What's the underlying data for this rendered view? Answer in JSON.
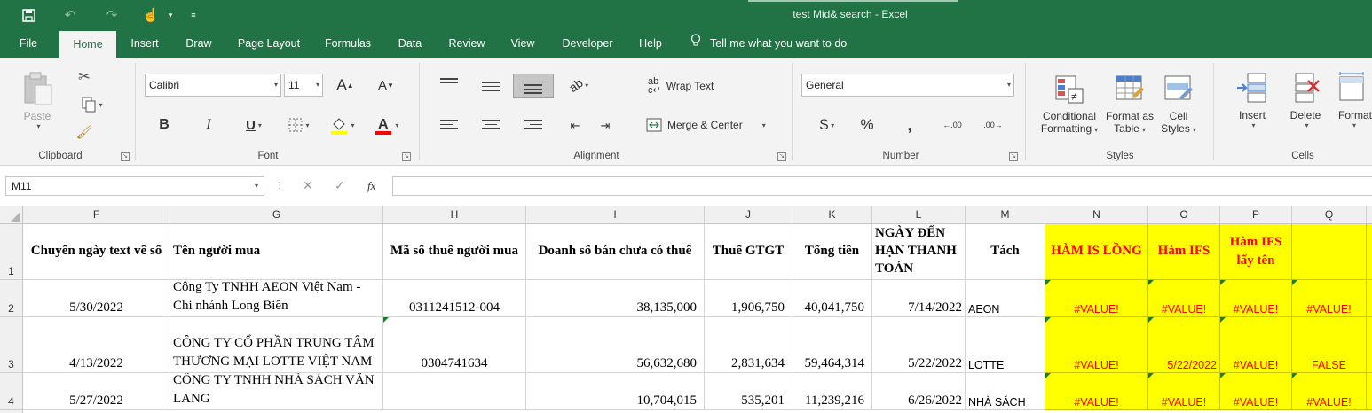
{
  "window": {
    "title": "test Mid& search  -  Excel"
  },
  "tabs": [
    "File",
    "Home",
    "Insert",
    "Draw",
    "Page Layout",
    "Formulas",
    "Data",
    "Review",
    "View",
    "Developer",
    "Help"
  ],
  "active_tab": "Home",
  "tell_me": "Tell me what you want to do",
  "ribbon": {
    "clipboard": {
      "paste": "Paste",
      "label": "Clipboard"
    },
    "font": {
      "name": "Calibri",
      "size": "11",
      "grow": "A",
      "shrink": "A",
      "bold": "B",
      "italic": "I",
      "underline": "U",
      "label": "Font"
    },
    "alignment": {
      "wrap": "Wrap Text",
      "merge": "Merge & Center",
      "label": "Alignment"
    },
    "number": {
      "format": "General",
      "currency": "$",
      "percent": "%",
      "comma": ",",
      "inc_decimal": ".00",
      "dec_decimal": ".00",
      "label": "Number"
    },
    "styles": {
      "conditional_1": "Conditional",
      "conditional_2": "Formatting",
      "table_1": "Format as",
      "table_2": "Table",
      "cell_1": "Cell",
      "cell_2": "Styles",
      "label": "Styles"
    },
    "cells": {
      "insert": "Insert",
      "delete": "Delete",
      "format": "Format",
      "label": "Cells"
    }
  },
  "formula_bar": {
    "name_box": "M11",
    "fx": "fx",
    "formula": ""
  },
  "sheet": {
    "columns": [
      "F",
      "G",
      "H",
      "I",
      "J",
      "K",
      "L",
      "M",
      "N",
      "O",
      "P",
      "Q"
    ],
    "row_numbers": [
      "1",
      "2",
      "3",
      "4"
    ],
    "header_row": {
      "F": "Chuyển ngày text về số",
      "G": "Tên người mua",
      "H": "Mã số thuế người mua",
      "I": "Doanh số bán chưa có thuế",
      "J": "Thuế GTGT",
      "K": "Tổng tiền",
      "L": "NGÀY ĐẾN HẠN THANH TOÁN",
      "M": "Tách",
      "N": "HÀM IS LỒNG",
      "O": "Hàm IFS",
      "P": "Hàm IFS lấy tên",
      "Q": ""
    },
    "rows": [
      {
        "F": "5/30/2022",
        "G": "Công Ty TNHH AEON Việt Nam - Chi nhánh Long Biên",
        "H": "0311241512-004",
        "I": "38,135,000",
        "J": "1,906,750",
        "K": "40,041,750",
        "L": "7/14/2022",
        "M": "AEON",
        "N": "#VALUE!",
        "O": "#VALUE!",
        "P": "#VALUE!",
        "Q": "#VALUE!"
      },
      {
        "F": "4/13/2022",
        "G": "CÔNG TY CỔ PHẦN TRUNG TÂM THƯƠNG MẠI LOTTE VIỆT NAM",
        "H": "0304741634",
        "I": "56,632,680",
        "J": "2,831,634",
        "K": "59,464,314",
        "L": "5/22/2022",
        "M": "LOTTE",
        "N": "#VALUE!",
        "O": "5/22/2022",
        "P": "#VALUE!",
        "Q": "FALSE"
      },
      {
        "F": "5/27/2022",
        "G": "CÔNG TY TNHH NHÀ SÁCH VĂN LANG",
        "H": "",
        "I": "10,704,015",
        "J": "535,201",
        "K": "11,239,216",
        "L": "6/26/2022",
        "M": "NHÀ SÁCH",
        "N": "#VALUE!",
        "O": "#VALUE!",
        "P": "#VALUE!",
        "Q": "#VALUE!"
      }
    ]
  },
  "colors": {
    "excel_green": "#217346",
    "highlight_yellow": "#ffff00",
    "error_red": "#ff0000"
  }
}
